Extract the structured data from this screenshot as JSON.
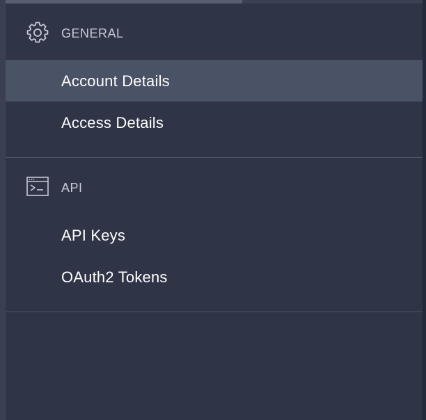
{
  "colors": {
    "background": "#2f3446",
    "active_item": "#4a5266",
    "divider": "#4c5264",
    "section_title": "#c7cad8",
    "item_text": "#ffffff"
  },
  "sections": [
    {
      "icon": "gear-icon",
      "title": "GENERAL",
      "items": [
        {
          "label": "Account Details",
          "active": true
        },
        {
          "label": "Access Details",
          "active": false
        }
      ]
    },
    {
      "icon": "terminal-window-icon",
      "title": "API",
      "items": [
        {
          "label": "API Keys",
          "active": false
        },
        {
          "label": "OAuth2 Tokens",
          "active": false
        }
      ]
    }
  ]
}
